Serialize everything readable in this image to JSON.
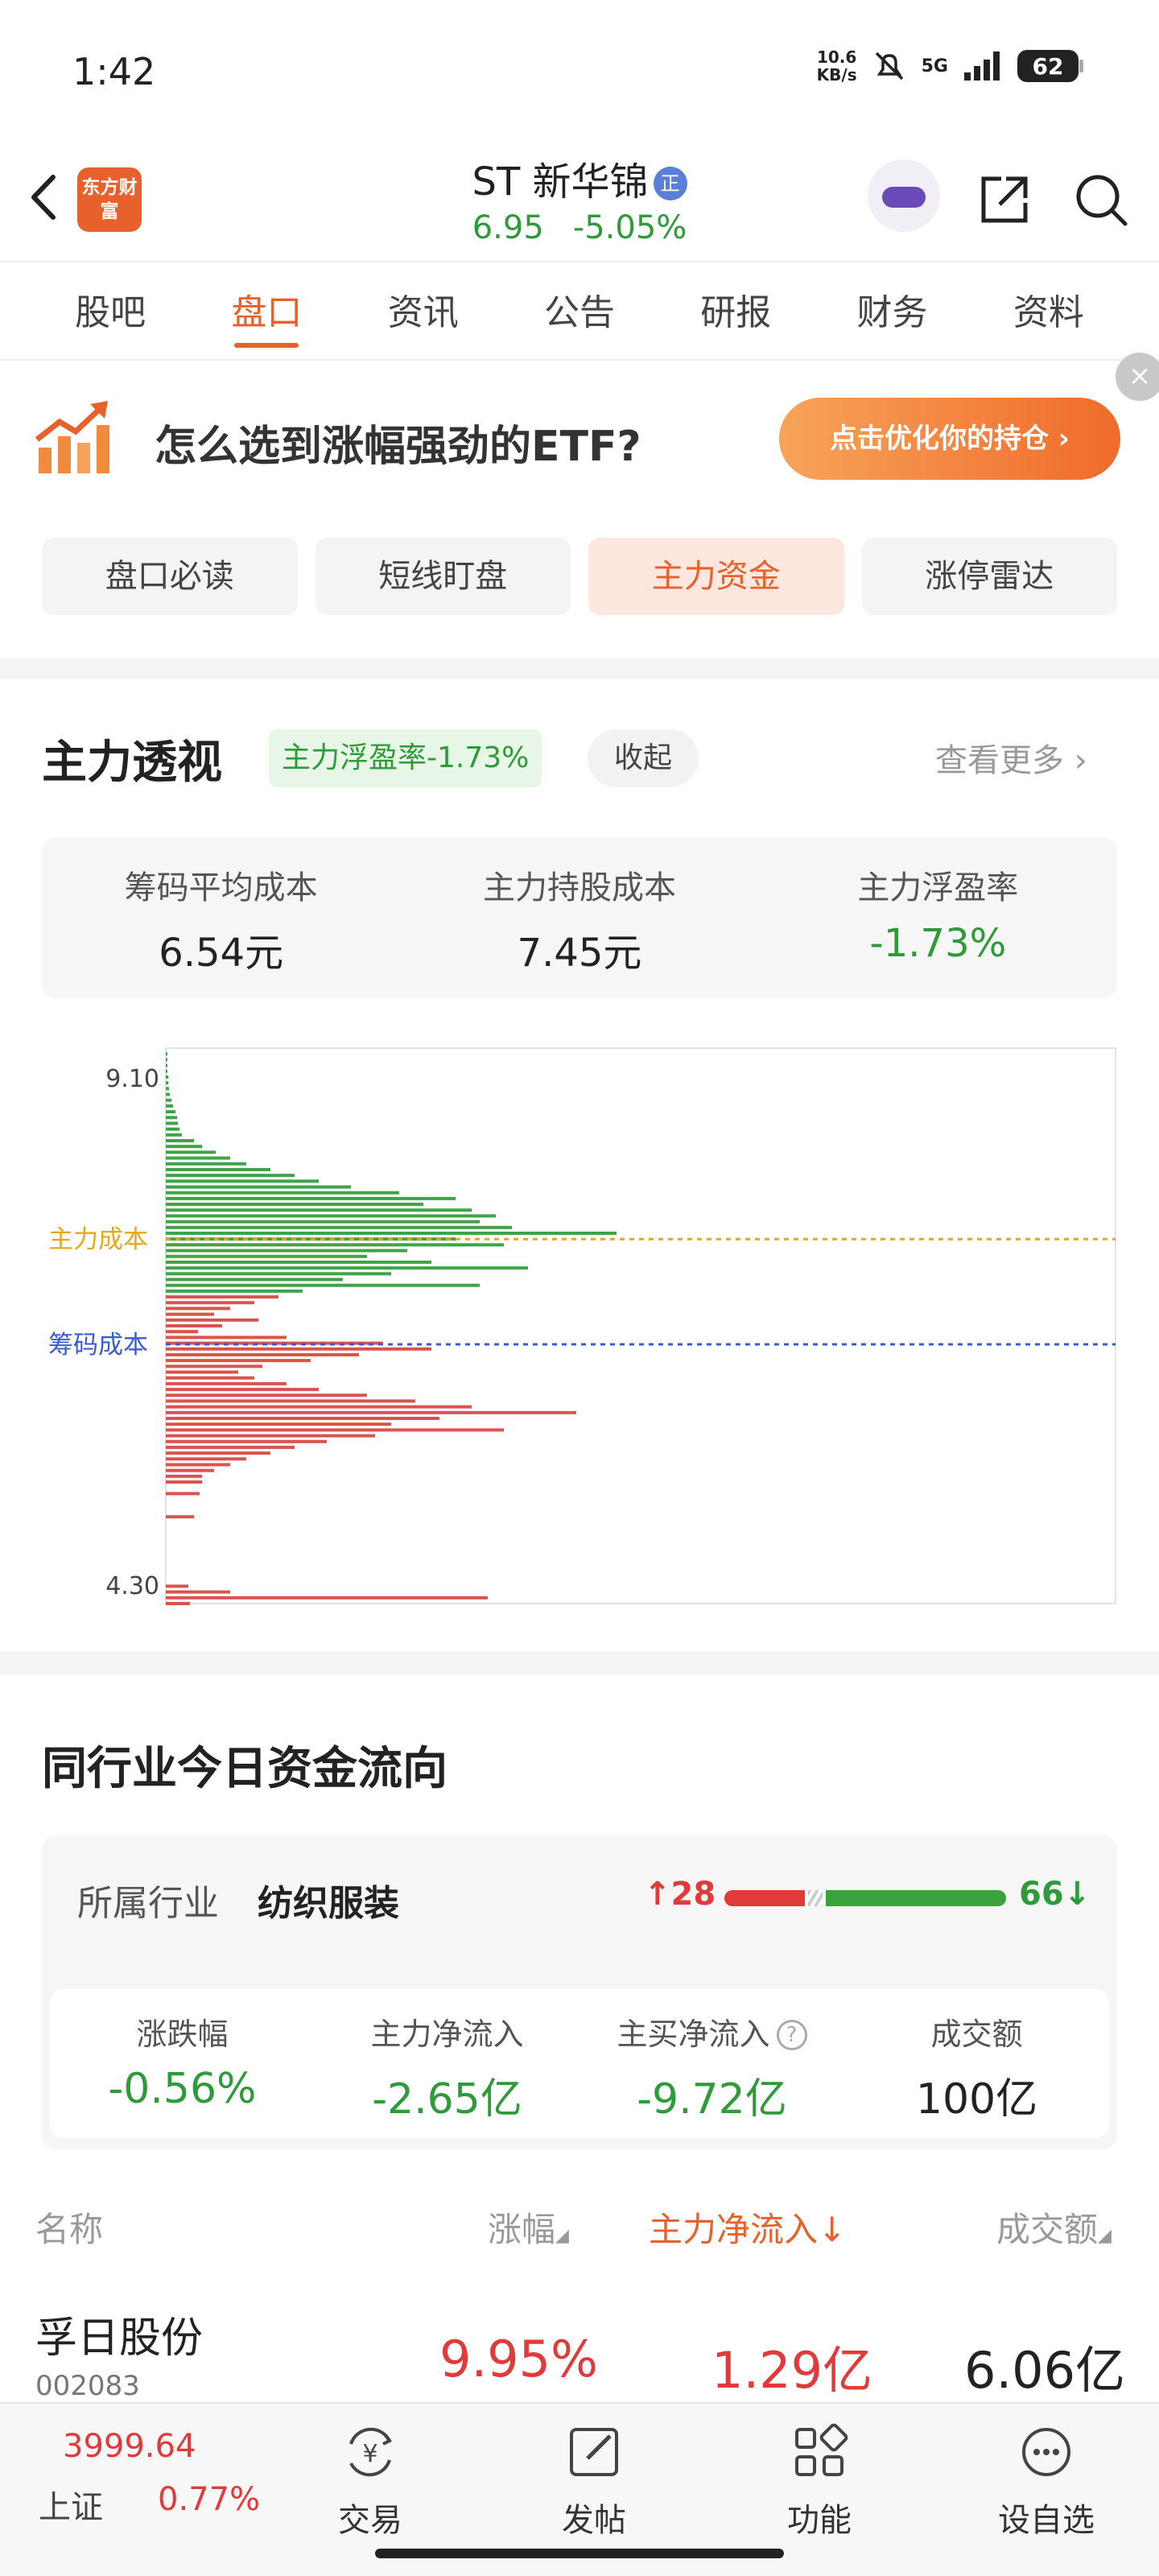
{
  "status_bar": {
    "time": "1:42",
    "net_speed_value": "10.6",
    "net_speed_unit": "KB/s",
    "signal": "5G",
    "battery": "62"
  },
  "header": {
    "logo_text": "东方财富",
    "stock_name": "ST 新华锦",
    "badge": "正",
    "price": "6.95",
    "change": "-5.05%"
  },
  "tabs": [
    "股吧",
    "盘口",
    "资讯",
    "公告",
    "研报",
    "财务",
    "资料"
  ],
  "active_tab": "盘口",
  "ad": {
    "text": "怎么选到涨幅强劲的ETF?",
    "button": "点击优化你的持仓"
  },
  "sub_tabs": [
    "盘口必读",
    "短线盯盘",
    "主力资金",
    "涨停雷达"
  ],
  "active_sub_tab": "主力资金",
  "main_view": {
    "title": "主力透视",
    "float_tag": "主力浮盈率-1.73%",
    "collapse": "收起",
    "more": "查看更多",
    "stats": [
      {
        "label": "筹码平均成本",
        "value": "6.54元",
        "color": "black"
      },
      {
        "label": "主力持股成本",
        "value": "7.45元",
        "color": "black"
      },
      {
        "label": "主力浮盈率",
        "value": "-1.73%",
        "color": "green"
      }
    ]
  },
  "chart_data": {
    "type": "bar",
    "orientation": "horizontal",
    "title": "",
    "y_top_label": "9.10",
    "y_bottom_label": "4.30",
    "ylim": [
      4.3,
      9.1
    ],
    "reference_lines": [
      {
        "label": "主力成本",
        "price": 7.45,
        "color": "#e6a817"
      },
      {
        "label": "筹码成本",
        "price": 6.54,
        "color": "#3b5bd6"
      }
    ],
    "profit_color": "#3fa347",
    "loss_color": "#d9534f",
    "price_split": 6.95,
    "bars": [
      {
        "price": 9.05,
        "value": 1
      },
      {
        "price": 9.0,
        "value": 1
      },
      {
        "price": 8.95,
        "value": 2
      },
      {
        "price": 8.9,
        "value": 2
      },
      {
        "price": 8.85,
        "value": 3
      },
      {
        "price": 8.8,
        "value": 3
      },
      {
        "price": 8.75,
        "value": 4
      },
      {
        "price": 8.7,
        "value": 5
      },
      {
        "price": 8.65,
        "value": 7
      },
      {
        "price": 8.6,
        "value": 9
      },
      {
        "price": 8.55,
        "value": 12
      },
      {
        "price": 8.5,
        "value": 14
      },
      {
        "price": 8.45,
        "value": 15
      },
      {
        "price": 8.4,
        "value": 17
      },
      {
        "price": 8.35,
        "value": 20
      },
      {
        "price": 8.3,
        "value": 35
      },
      {
        "price": 8.25,
        "value": 45
      },
      {
        "price": 8.2,
        "value": 62
      },
      {
        "price": 8.15,
        "value": 80
      },
      {
        "price": 8.1,
        "value": 100
      },
      {
        "price": 8.05,
        "value": 130
      },
      {
        "price": 8.0,
        "value": 160
      },
      {
        "price": 7.95,
        "value": 190
      },
      {
        "price": 7.9,
        "value": 230
      },
      {
        "price": 7.85,
        "value": 290
      },
      {
        "price": 7.8,
        "value": 360
      },
      {
        "price": 7.75,
        "value": 320
      },
      {
        "price": 7.7,
        "value": 380
      },
      {
        "price": 7.65,
        "value": 410
      },
      {
        "price": 7.6,
        "value": 390
      },
      {
        "price": 7.55,
        "value": 430
      },
      {
        "price": 7.5,
        "value": 560
      },
      {
        "price": 7.45,
        "value": 360
      },
      {
        "price": 7.4,
        "value": 420
      },
      {
        "price": 7.35,
        "value": 300
      },
      {
        "price": 7.3,
        "value": 250
      },
      {
        "price": 7.25,
        "value": 330
      },
      {
        "price": 7.2,
        "value": 450
      },
      {
        "price": 7.15,
        "value": 280
      },
      {
        "price": 7.1,
        "value": 220
      },
      {
        "price": 7.05,
        "value": 390
      },
      {
        "price": 7.0,
        "value": 170
      },
      {
        "price": 6.95,
        "value": 140
      },
      {
        "price": 6.9,
        "value": 110
      },
      {
        "price": 6.85,
        "value": 80
      },
      {
        "price": 6.8,
        "value": 60
      },
      {
        "price": 6.75,
        "value": 115
      },
      {
        "price": 6.7,
        "value": 70
      },
      {
        "price": 6.65,
        "value": 40
      },
      {
        "price": 6.6,
        "value": 150
      },
      {
        "price": 6.55,
        "value": 270
      },
      {
        "price": 6.5,
        "value": 330
      },
      {
        "price": 6.45,
        "value": 240
      },
      {
        "price": 6.4,
        "value": 180
      },
      {
        "price": 6.35,
        "value": 120
      },
      {
        "price": 6.3,
        "value": 90
      },
      {
        "price": 6.25,
        "value": 110
      },
      {
        "price": 6.2,
        "value": 150
      },
      {
        "price": 6.15,
        "value": 190
      },
      {
        "price": 6.1,
        "value": 250
      },
      {
        "price": 6.05,
        "value": 310
      },
      {
        "price": 6.0,
        "value": 380
      },
      {
        "price": 5.95,
        "value": 510
      },
      {
        "price": 5.9,
        "value": 340
      },
      {
        "price": 5.85,
        "value": 280
      },
      {
        "price": 5.8,
        "value": 420
      },
      {
        "price": 5.75,
        "value": 260
      },
      {
        "price": 5.7,
        "value": 200
      },
      {
        "price": 5.65,
        "value": 160
      },
      {
        "price": 5.6,
        "value": 130
      },
      {
        "price": 5.55,
        "value": 100
      },
      {
        "price": 5.5,
        "value": 80
      },
      {
        "price": 5.45,
        "value": 60
      },
      {
        "price": 5.4,
        "value": 45
      },
      {
        "price": 5.35,
        "value": 45
      },
      {
        "price": 5.25,
        "value": 42
      },
      {
        "price": 5.05,
        "value": 35
      },
      {
        "price": 4.45,
        "value": 28
      },
      {
        "price": 4.4,
        "value": 80
      },
      {
        "price": 4.35,
        "value": 400
      },
      {
        "price": 4.3,
        "value": 30
      }
    ]
  },
  "industry": {
    "title": "同行业今日资金流向",
    "label": "所属行业",
    "name": "纺织服装",
    "up_count": "28",
    "down_count": "66",
    "stats": [
      {
        "label": "涨跌幅",
        "value": "-0.56%",
        "color": "green"
      },
      {
        "label": "主力净流入",
        "value": "-2.65亿",
        "color": "green"
      },
      {
        "label": "主买净流入",
        "value": "-9.72亿",
        "color": "green"
      },
      {
        "label": "成交额",
        "value": "100亿",
        "color": "black"
      }
    ]
  },
  "table": {
    "headers": [
      "名称",
      "涨幅",
      "主力净流入",
      "成交额"
    ],
    "rows": [
      {
        "name": "孚日股份",
        "code": "002083",
        "change": "9.95%",
        "net_inflow": "1.29亿",
        "turnover": "6.06亿"
      }
    ]
  },
  "bottom_nav": {
    "index_value": "3999.64",
    "index_name": "上证",
    "index_change": "0.77%",
    "items": [
      "交易",
      "发帖",
      "功能",
      "设自选"
    ]
  }
}
